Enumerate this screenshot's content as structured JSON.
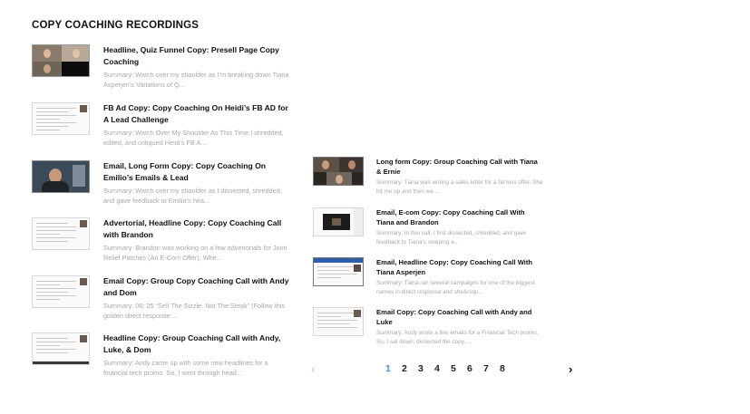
{
  "section": {
    "title": "COPY COACHING RECORDINGS"
  },
  "left_items": [
    {
      "title": "Headline, Quiz Funnel Copy: Presell Page Copy Coaching",
      "summary": "Summary: Watch over my shoulder as I’m breaking down Tiana Asperjen’s Variations of Q...",
      "thumb": "video-call"
    },
    {
      "title": "FB Ad Copy: Copy Coaching On Heidi’s FB AD for A Lead Challenge",
      "summary": "Summary: Watch Over My Shoulder As This Time I shredded, edited, and critiqued Heidi’s FB A...",
      "thumb": "document"
    },
    {
      "title": "Email, Long Form Copy: Copy Coaching On Emilio’s Emails & Lead",
      "summary": "Summary: Watch over my shoulder as I dissected, shredded, and gave feedback to Emilio’s hea...",
      "thumb": "webcam"
    },
    {
      "title": "Advertorial, Headline Copy: Copy Coaching Call with Brandon",
      "summary": "Summary: Brandon was working on a few advertorials for Joint Relief Patches (An E-Com Offer). Whe...",
      "thumb": "document"
    },
    {
      "title": "Email Copy: Group Copy Coaching Call with Andy and Dom",
      "summary": "Summary: 06: 25 “Sell The Sizzle. Not The Steak” (Follow this golden direct response ...",
      "thumb": "document"
    },
    {
      "title": "Headline Copy: Group Coaching Call with Andy, Luke, & Dom",
      "summary": "Summary: Andy came up with some new headlines for a financial tech promo. So, I went through head...",
      "thumb": "document-dark"
    }
  ],
  "right_items": [
    {
      "title": "Long form Copy: Group Coaching Call with Tiana & Ernie",
      "summary": "Summary: Tiana was writing a sales letter for a fat loss offer. She hit me up and then we ...",
      "thumb": "video-call"
    },
    {
      "title": "Email, E-com Copy: Copy Coaching Call With Tiana and Brandon",
      "summary": "Summary: In this call, I first dissected, shredded, and gave feedback to Tiana’s sleeping e...",
      "thumb": "screen-video"
    },
    {
      "title": "Email, Headline Copy: Copy Coaching Call With Tiana Asperjen",
      "summary": "Summary: Tiana ran several campaigns for one of the biggest names in direct response and she&rsqu...",
      "thumb": "screen-blue"
    },
    {
      "title": "Email Copy: Copy Coaching Call with Andy and Luke",
      "summary": "Summary: Andy wrote a few emails for a Financial Tech promo. So, I sat down, dissected the copy, ...",
      "thumb": "document"
    }
  ],
  "pagination": {
    "prev": "‹",
    "next": "›",
    "pages": [
      "1",
      "2",
      "3",
      "4",
      "5",
      "6",
      "7",
      "8"
    ],
    "active": "1"
  },
  "colors": {
    "active_page": "#4a8fd6",
    "summary_text": "#a8a8a8",
    "title_text": "#111111"
  }
}
